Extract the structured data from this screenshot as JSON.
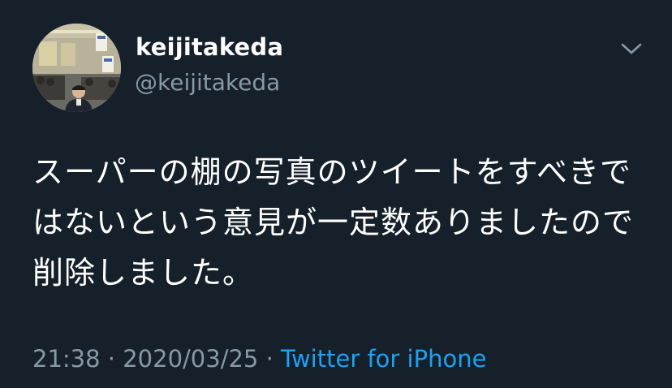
{
  "author": {
    "display_name": "keijitakeda",
    "handle": "@keijitakeda",
    "avatar_icon": "avatar-photo"
  },
  "menu": {
    "icon": "chevron-down-icon"
  },
  "tweet": {
    "text": "スーパーの棚の写真のツイートをすべきではないという意見が一定数ありましたので削除しました。"
  },
  "meta": {
    "time": "21:38",
    "separator1": " · ",
    "date": "2020/03/25",
    "separator2": " · ",
    "source": "Twitter for iPhone"
  },
  "colors": {
    "background": "#15202b",
    "primary_text": "#ffffff",
    "secondary_text": "#8899a6",
    "link": "#1da1f2"
  }
}
